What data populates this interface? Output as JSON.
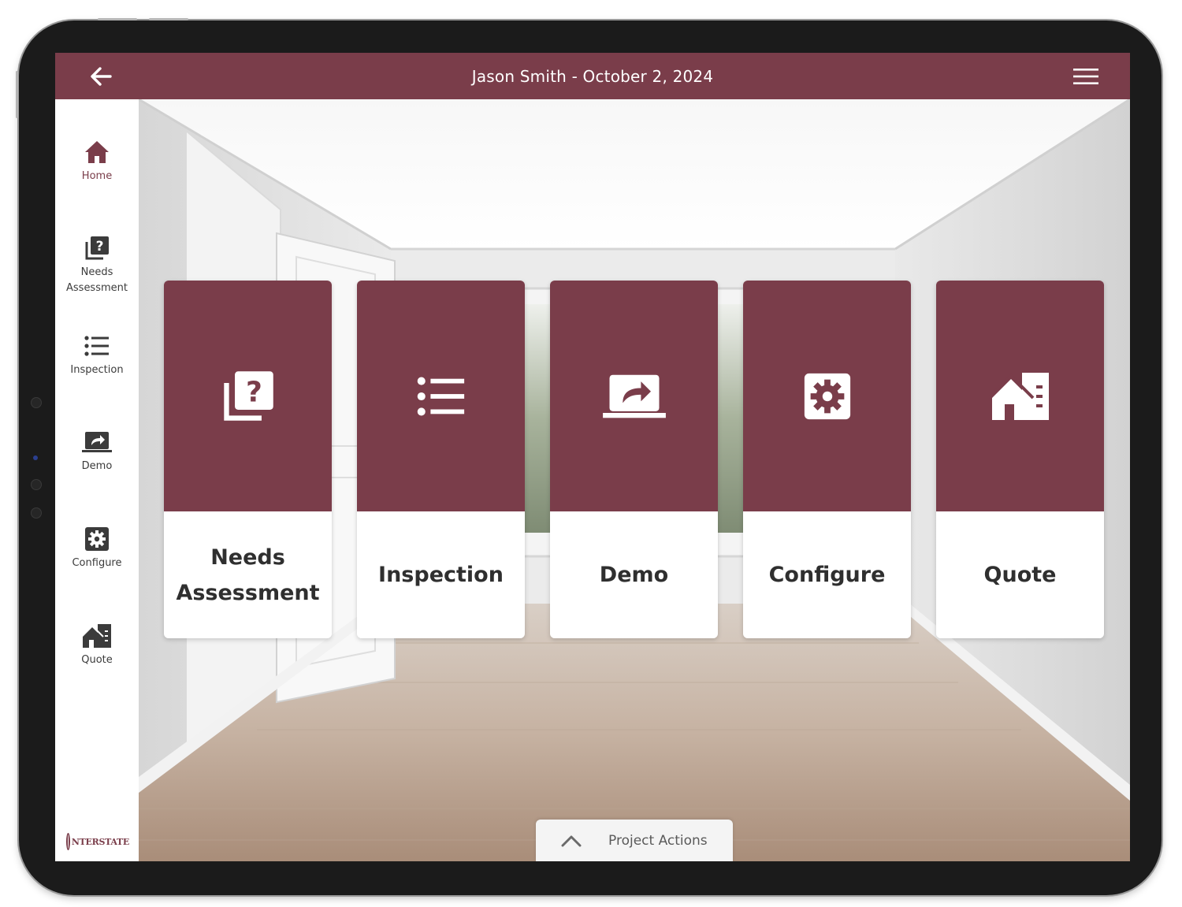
{
  "app": {
    "header": {
      "title": "Jason Smith - October 2, 2024",
      "back_icon": "arrow-left-icon",
      "menu_icon": "hamburger-menu-icon"
    },
    "colors": {
      "brand": "#7a3d4a",
      "sidebar_bg": "#ffffff",
      "card_label": "#2f2f2f"
    },
    "sidebar": {
      "items": [
        {
          "id": "home",
          "label": "Home",
          "icon": "home-icon",
          "active": true
        },
        {
          "id": "needs",
          "label": "Needs\nAssessment",
          "icon": "question-docs-icon",
          "active": false
        },
        {
          "id": "inspection",
          "label": "Inspection",
          "icon": "list-icon",
          "active": false
        },
        {
          "id": "demo",
          "label": "Demo",
          "icon": "screen-share-icon",
          "active": false
        },
        {
          "id": "configure",
          "label": "Configure",
          "icon": "gear-box-icon",
          "active": false
        },
        {
          "id": "quote",
          "label": "Quote",
          "icon": "house-quote-icon",
          "active": false
        }
      ],
      "logo_text": "NTERSTATE"
    },
    "cards": [
      {
        "id": "needs",
        "label": "Needs Assessment",
        "icon": "question-docs-icon"
      },
      {
        "id": "inspection",
        "label": "Inspection",
        "icon": "list-icon"
      },
      {
        "id": "demo",
        "label": "Demo",
        "icon": "screen-share-icon"
      },
      {
        "id": "configure",
        "label": "Configure",
        "icon": "gear-box-icon"
      },
      {
        "id": "quote",
        "label": "Quote",
        "icon": "house-quote-icon"
      }
    ],
    "project_actions": {
      "label": "Project Actions",
      "icon": "chevron-up-icon"
    }
  }
}
